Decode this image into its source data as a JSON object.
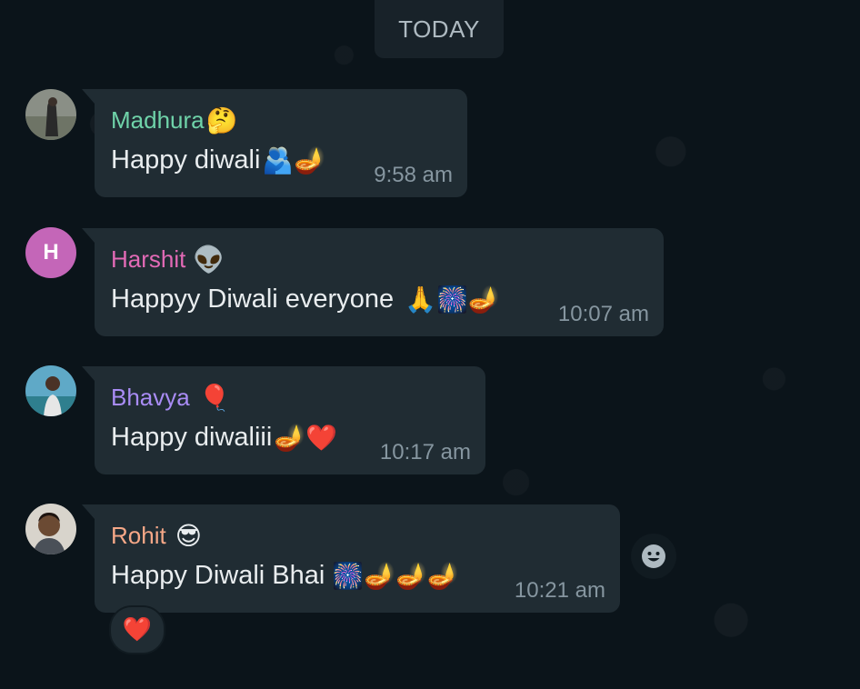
{
  "date_divider": "TODAY",
  "messages": [
    {
      "sender": "Madhura",
      "sender_emoji": "🤔",
      "sender_color": "#53bdeb",
      "text": "Happy diwali",
      "text_emoji": "🫂🪔",
      "time": "9:58 am",
      "avatar": "photo"
    },
    {
      "sender": "Harshit",
      "sender_emoji": "👽",
      "sender_color": "#e26ab6",
      "text": "Happyy Diwali everyone",
      "text_emoji": "🙏🎆🪔",
      "time": "10:07 am",
      "avatar": "H"
    },
    {
      "sender": "Bhavya",
      "sender_emoji": "🎈",
      "sender_color": "#a98cf5",
      "text": "Happy diwaliii",
      "text_emoji": "🪔❤️",
      "time": "10:17 am",
      "avatar": "photo"
    },
    {
      "sender": "Rohit",
      "sender_emoji": "😎",
      "sender_color": "#f5a787",
      "text": "Happy Diwali Bhai",
      "text_emoji": "🎆🪔🪔🪔",
      "time": "10:21 am",
      "avatar": "photo",
      "reaction": "❤️"
    }
  ],
  "react_button_icon": "emoji-reaction-icon"
}
